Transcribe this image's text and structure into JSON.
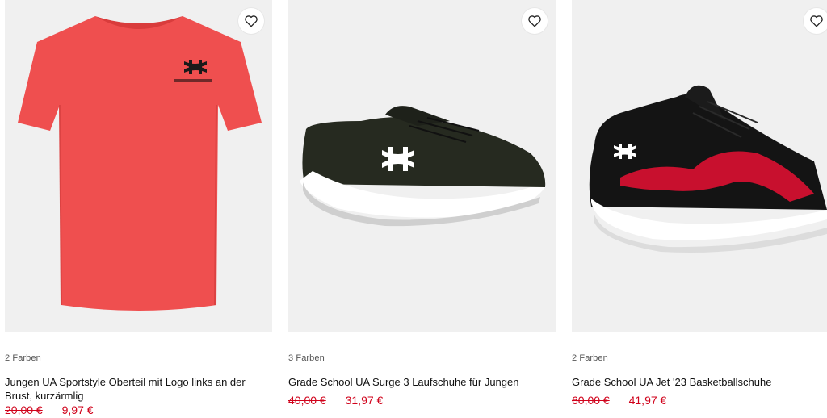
{
  "products": [
    {
      "colors": "2 Farben",
      "name": "Jungen UA Sportstyle Oberteil mit Logo links an der Brust, kurzärmlig",
      "old_price": "20,00 €",
      "price": "9,97 €",
      "image": "red-tshirt"
    },
    {
      "colors": "3 Farben",
      "name": "Grade School UA Surge 3 Laufschuhe für Jungen",
      "old_price": "40,00 €",
      "price": "31,97 €",
      "image": "olive-running-shoe"
    },
    {
      "colors": "2 Farben",
      "name": "Grade School UA Jet '23 Basketballschuhe",
      "old_price": "60,00 €",
      "price": "41,97 €",
      "image": "black-red-basketball-shoe"
    }
  ],
  "icons": {
    "favorite": "heart-icon",
    "brand": "under-armour-logo"
  },
  "colors": {
    "sale": "#d0021b",
    "tile_bg": "#f0f0f0",
    "shirt": "#ef4f4f"
  }
}
